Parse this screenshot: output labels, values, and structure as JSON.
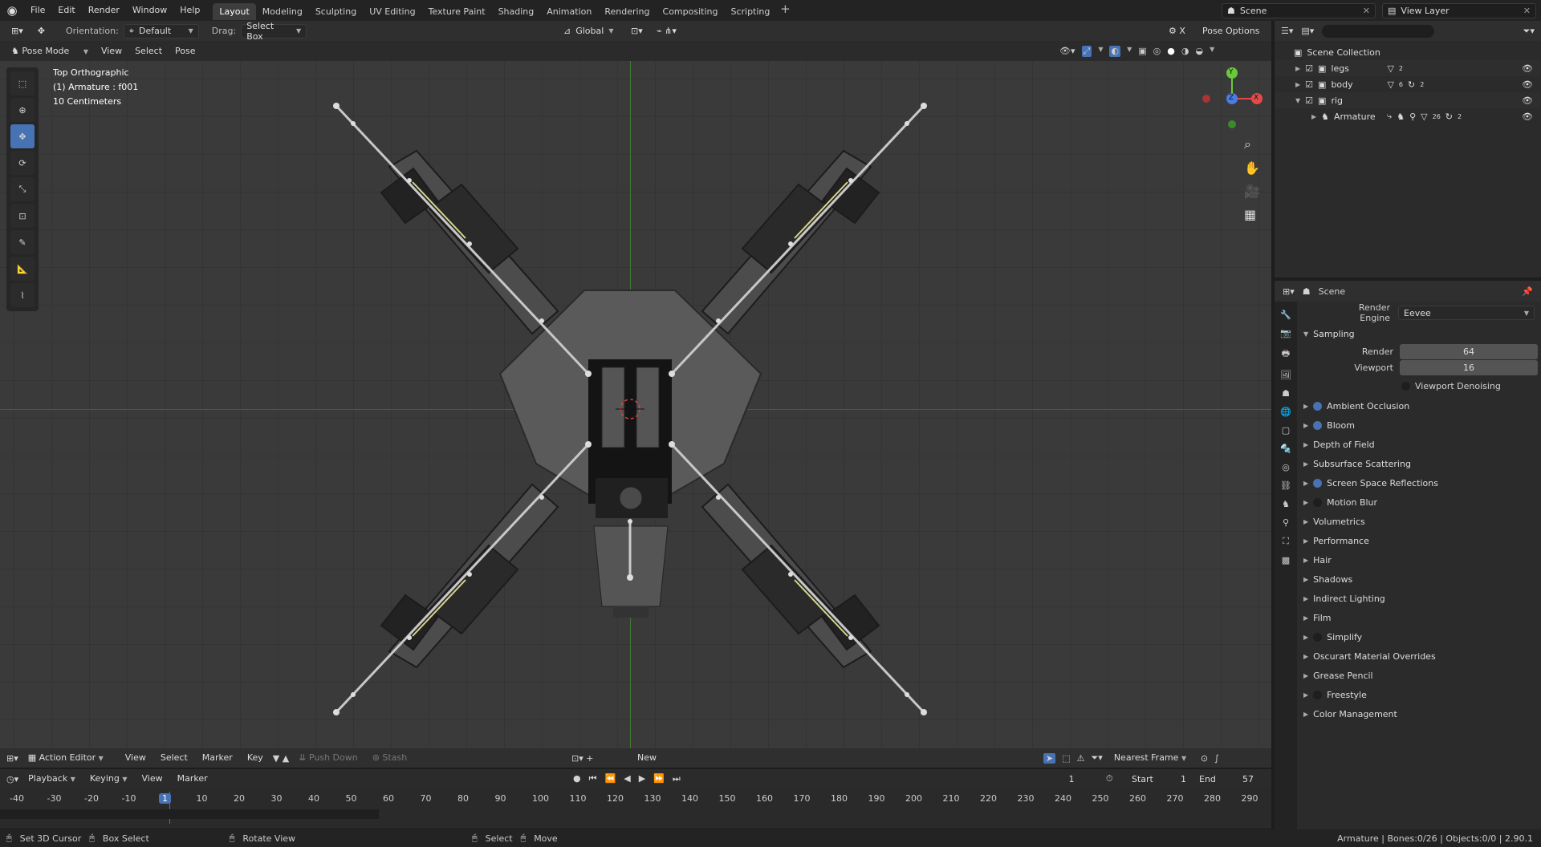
{
  "topbar": {
    "menus": [
      "File",
      "Edit",
      "Render",
      "Window",
      "Help"
    ],
    "workspaces": [
      "Layout",
      "Modeling",
      "Sculpting",
      "UV Editing",
      "Texture Paint",
      "Shading",
      "Animation",
      "Rendering",
      "Compositing",
      "Scripting"
    ],
    "scene": "Scene",
    "view_layer": "View Layer"
  },
  "toolheader": {
    "orientation_label": "Orientation:",
    "orientation_value": "Default",
    "drag_label": "Drag:",
    "drag_value": "Select Box",
    "transform": "Global",
    "pose_options": "Pose Options"
  },
  "viewheader": {
    "mode": "Pose Mode",
    "menus": [
      "View",
      "Select",
      "Pose"
    ]
  },
  "viewport": {
    "view_name": "Top Orthographic",
    "object": "(1) Armature : f001",
    "scale": "10 Centimeters",
    "gizmo": {
      "x": "X",
      "y": "Y",
      "z": "Z"
    }
  },
  "outliner": {
    "title": "Scene Collection",
    "items": [
      {
        "name": "legs",
        "badge": "2"
      },
      {
        "name": "body",
        "badge": "6",
        "badge2": "2"
      },
      {
        "name": "rig"
      },
      {
        "name": "Armature",
        "badge": "26",
        "badge2": "2"
      }
    ]
  },
  "properties": {
    "scene": "Scene",
    "render_engine_label": "Render Engine",
    "render_engine": "Eevee",
    "sampling": "Sampling",
    "render_label": "Render",
    "render_value": "64",
    "viewport_label": "Viewport",
    "viewport_value": "16",
    "denoise": "Viewport Denoising",
    "sections": [
      {
        "name": "Ambient Occlusion",
        "dot": "blue"
      },
      {
        "name": "Bloom",
        "dot": "blue"
      },
      {
        "name": "Depth of Field",
        "dot": ""
      },
      {
        "name": "Subsurface Scattering",
        "dot": ""
      },
      {
        "name": "Screen Space Reflections",
        "dot": "blue"
      },
      {
        "name": "Motion Blur",
        "dot": "dark"
      },
      {
        "name": "Volumetrics",
        "dot": ""
      },
      {
        "name": "Performance",
        "dot": ""
      },
      {
        "name": "Hair",
        "dot": ""
      },
      {
        "name": "Shadows",
        "dot": ""
      },
      {
        "name": "Indirect Lighting",
        "dot": ""
      },
      {
        "name": "Film",
        "dot": ""
      },
      {
        "name": "Simplify",
        "dot": "dark"
      },
      {
        "name": "Oscurart Material Overrides",
        "dot": ""
      },
      {
        "name": "Grease Pencil",
        "dot": ""
      },
      {
        "name": "Freestyle",
        "dot": "dark"
      },
      {
        "name": "Color Management",
        "dot": ""
      }
    ]
  },
  "action_editor": {
    "mode": "Action Editor",
    "menus": [
      "View",
      "Select",
      "Marker",
      "Key"
    ],
    "push_down": "Push Down",
    "stash": "Stash",
    "new": "New",
    "snap": "Nearest Frame"
  },
  "timeline": {
    "menus": [
      "Playback",
      "Keying",
      "View",
      "Marker"
    ],
    "current_frame": "1",
    "start_label": "Start",
    "start": "1",
    "end_label": "End",
    "end": "57",
    "ticks": [
      "-40",
      "-30",
      "-20",
      "-10",
      "1",
      "10",
      "20",
      "30",
      "40",
      "50",
      "60",
      "70",
      "80",
      "90",
      "100",
      "110",
      "120",
      "130",
      "140",
      "150",
      "160",
      "170",
      "180",
      "190",
      "200",
      "210",
      "220",
      "230",
      "240",
      "250",
      "260",
      "270",
      "280",
      "290"
    ]
  },
  "statusbar": {
    "items": [
      "Set 3D Cursor",
      "Box Select",
      "Rotate View",
      "Select",
      "Move"
    ],
    "stats": "Armature | Bones:0/26 | Objects:0/0 | 2.90.1"
  },
  "colors": {
    "accent": "#4772b3",
    "x_axis": "#e34b4b",
    "y_axis": "#6ac93a",
    "z_axis": "#4b7be3"
  }
}
